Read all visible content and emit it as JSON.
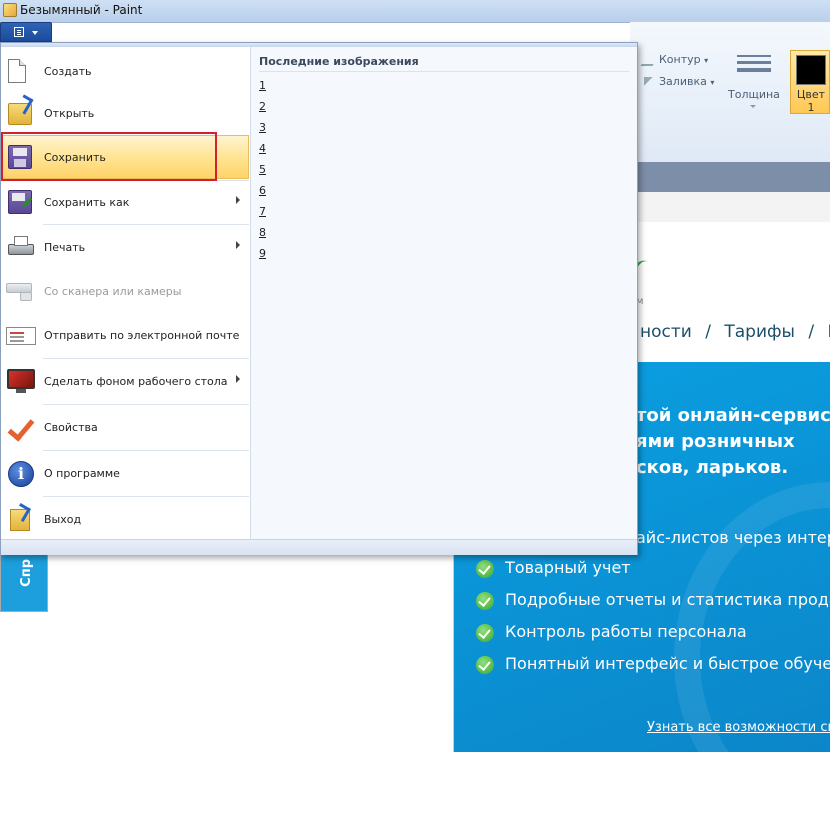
{
  "window": {
    "title": "Безымянный - Paint"
  },
  "ribbon": {
    "outline_label": "Контур",
    "fill_label": "Заливка",
    "thickness_label": "Толщина",
    "color_label_line1": "Цвет",
    "color_label_line2": "1",
    "color_value": "#000000"
  },
  "app_menu": {
    "items": [
      {
        "label": "Создать"
      },
      {
        "label": "Открыть"
      },
      {
        "label": "Сохранить"
      },
      {
        "label": "Сохранить как"
      },
      {
        "label": "Печать"
      },
      {
        "label": "Со сканера или камеры"
      },
      {
        "label": "Отправить по электронной почте"
      },
      {
        "label": "Сделать фоном рабочего стола"
      },
      {
        "label": "Свойства"
      },
      {
        "label": "О программе"
      },
      {
        "label": "Выход"
      }
    ],
    "recent_title": "Последние изображения",
    "recent": [
      "1",
      "2",
      "3",
      "4",
      "5",
      "6",
      "7",
      "8",
      "9"
    ]
  },
  "website": {
    "nav": [
      "ности",
      "/",
      "Тарифы",
      "/",
      "По"
    ],
    "headline_lines": [
      "той онлайн-сервис",
      "ями розничных",
      "сков, ларьков."
    ],
    "price_fragment": "айс-листов через интер",
    "features": [
      "Товарный учет",
      "Подробные отчеты и статистика прода",
      "Контроль работы персонала",
      "Понятный интерфейс и быстрое обучен"
    ],
    "more_link": "Узнать все возможности сист",
    "side_tab": "Спр",
    "logo_letter": "м"
  }
}
